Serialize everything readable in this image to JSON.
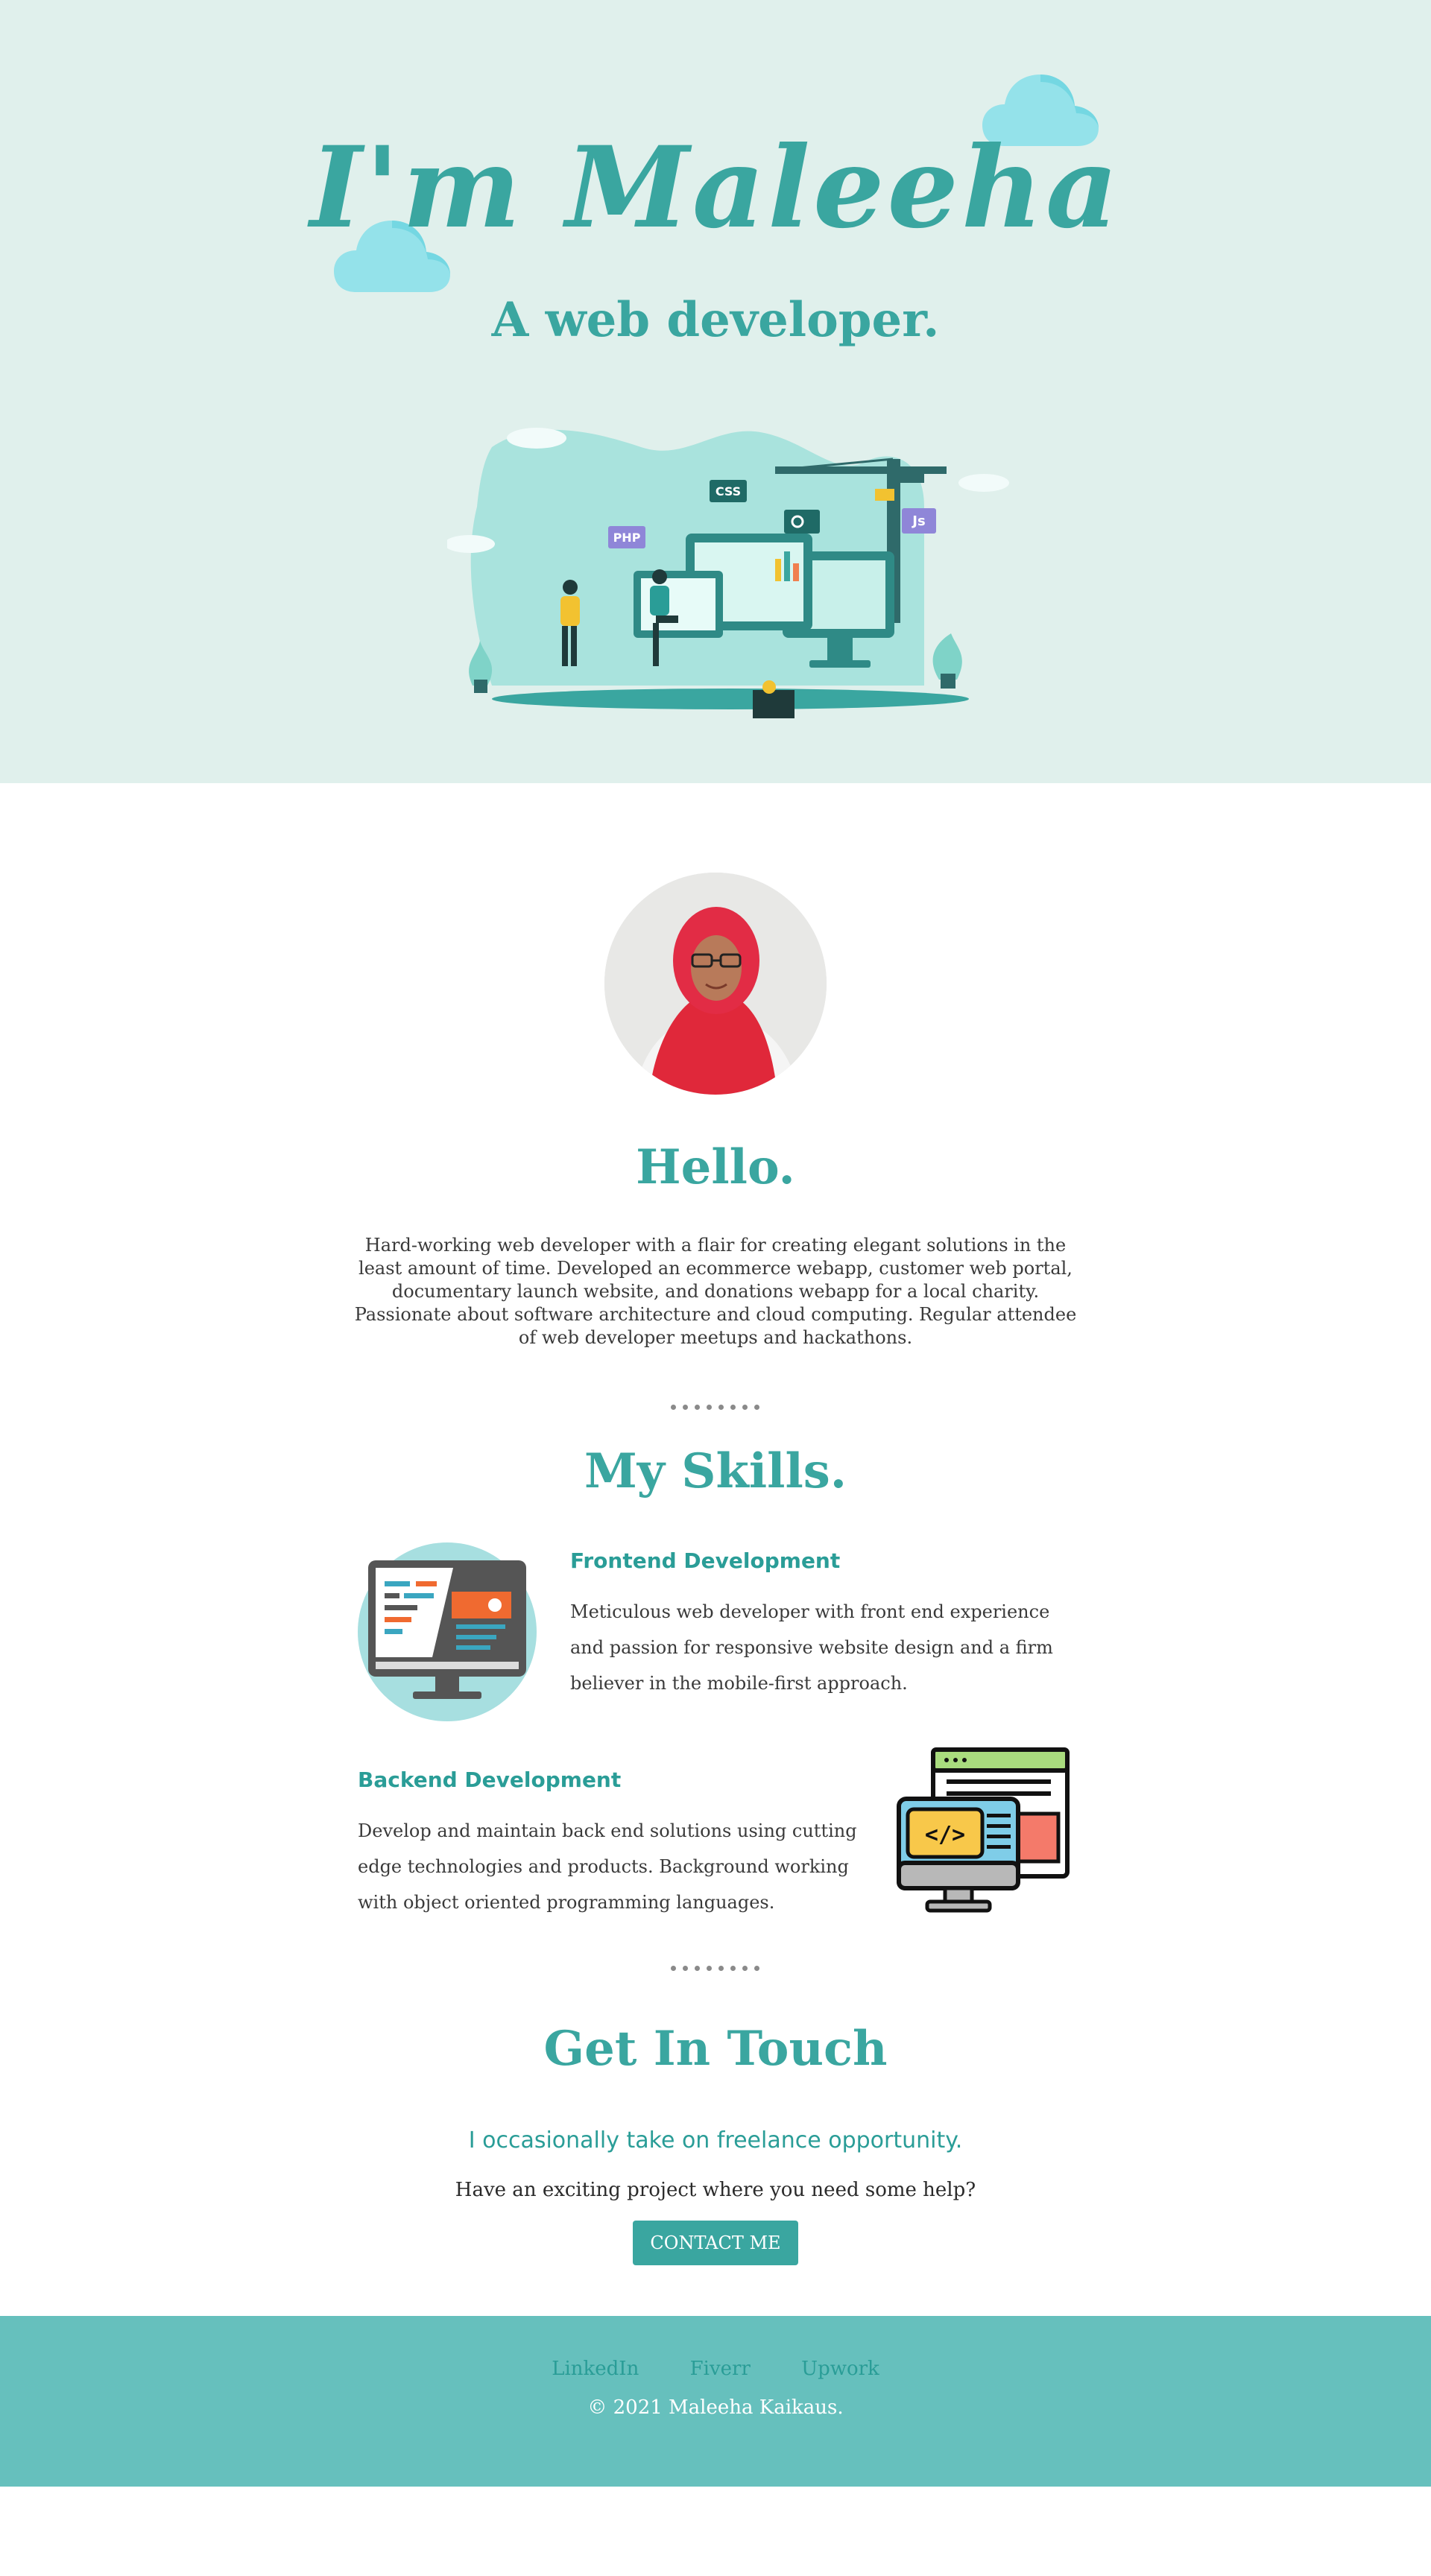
{
  "hero": {
    "title": "I'm Maleeha",
    "subtitle": "A web developer.",
    "illustration_labels": {
      "css": "CSS",
      "php": "PHP",
      "js": "Js"
    }
  },
  "about": {
    "title": "Hello.",
    "text": "Hard-working web developer with a flair for creating elegant solutions in the least amount of time. Developed an ecommerce webapp, customer web portal, documentary launch website, and donations webapp for a local charity. Passionate about software architecture and cloud computing. Regular attendee of web developer meetups and hackathons."
  },
  "skills": {
    "title": "My Skills.",
    "items": [
      {
        "heading": "Frontend Development",
        "text": "Meticulous web developer with front end experience and passion for responsive website design and a firm believer in the mobile-first approach."
      },
      {
        "heading": "Backend Development",
        "text": "Develop and maintain back end solutions using cutting edge technologies and products. Background working with object oriented programming languages."
      }
    ]
  },
  "contact": {
    "title": "Get In Touch",
    "tagline": "I occasionally take on freelance opportunity.",
    "question": "Have an exciting project where you need some help?",
    "button": "CONTACT ME"
  },
  "footer": {
    "links": [
      "LinkedIn",
      "Fiverr",
      "Upwork"
    ],
    "copyright": "© 2021 Maleeha Kaikaus."
  },
  "colors": {
    "hero_bg": "#e0f0ec",
    "accent": "#3aa6a0",
    "footer_bg": "#66c0bd",
    "cloud": "#94e2ea"
  },
  "icons": [
    "cloud-icon",
    "developer-illustration",
    "profile-photo",
    "desktop-monitor-icon",
    "code-window-icon"
  ]
}
